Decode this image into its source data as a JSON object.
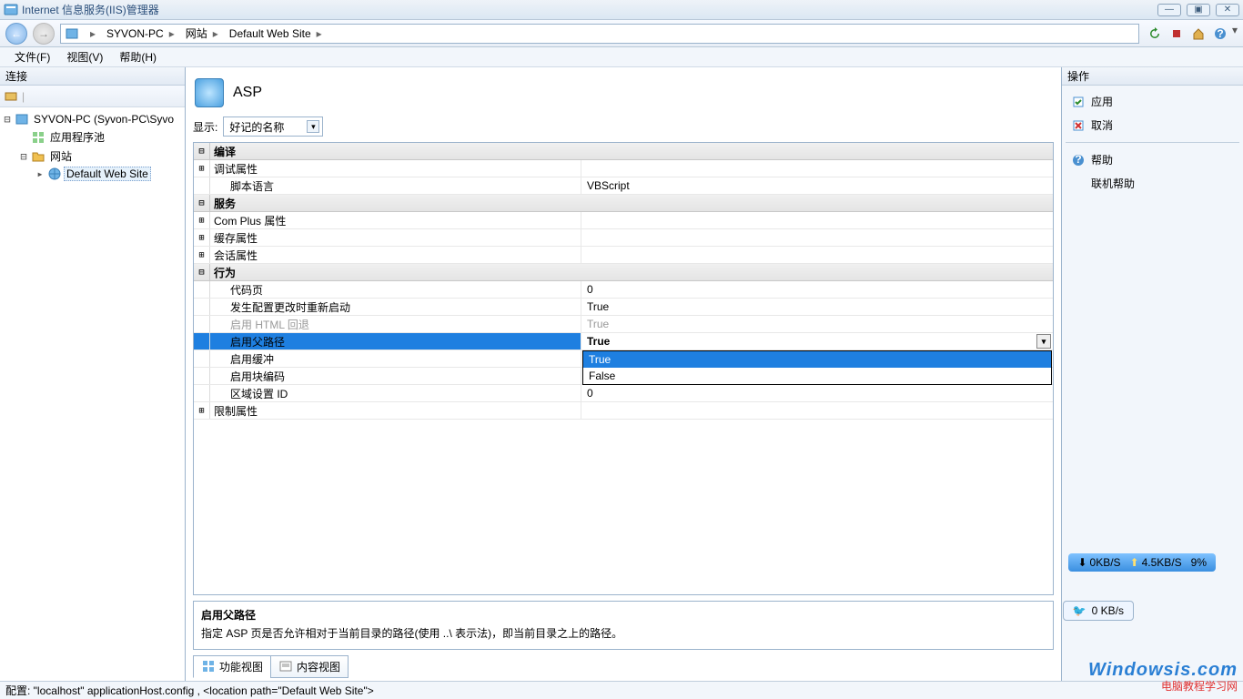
{
  "window": {
    "title": "Internet 信息服务(IIS)管理器"
  },
  "breadcrumbs": [
    "SYVON-PC",
    "网站",
    "Default Web Site"
  ],
  "menu": {
    "file": "文件(F)",
    "view": "视图(V)",
    "help": "帮助(H)"
  },
  "left": {
    "header": "连接",
    "nodes": {
      "root": "SYVON-PC (Syvon-PC\\Syvo",
      "app_pools": "应用程序池",
      "sites": "网站",
      "default_site": "Default Web Site"
    }
  },
  "page": {
    "title": "ASP",
    "filter_label": "显示:",
    "filter_value": "好记的名称"
  },
  "grid": {
    "cat_compile": "编译",
    "debug_props": "调试属性",
    "script_lang": {
      "label": "脚本语言",
      "value": "VBScript"
    },
    "cat_services": "服务",
    "complus": "Com Plus 属性",
    "cache_props": "缓存属性",
    "session_props": "会话属性",
    "cat_behavior": "行为",
    "codepage": {
      "label": "代码页",
      "value": "0"
    },
    "restart_on_cfg": {
      "label": "发生配置更改时重新启动",
      "value": "True"
    },
    "html_fallback": {
      "label": "启用 HTML 回退",
      "value": "True"
    },
    "parent_paths": {
      "label": "启用父路径",
      "value": "True",
      "options": [
        "True",
        "False"
      ]
    },
    "buffering": {
      "label": "启用缓冲",
      "value": ""
    },
    "chunked": {
      "label": "启用块编码",
      "value": ""
    },
    "locale_id": {
      "label": "区域设置 ID",
      "value": "0"
    },
    "limits": "限制属性"
  },
  "description": {
    "title": "启用父路径",
    "body": "指定 ASP 页是否允许相对于当前目录的路径(使用 ..\\ 表示法)，即当前目录之上的路径。"
  },
  "viewtabs": {
    "features": "功能视图",
    "content": "内容视图"
  },
  "right": {
    "header": "操作",
    "apply": "应用",
    "cancel": "取消",
    "help": "帮助",
    "online_help": "联机帮助"
  },
  "status": "配置:  \"localhost\"   applicationHost.config , <location path=\"Default Web Site\">",
  "overlay": {
    "down": "0KB/S",
    "up": "4.5KB/S",
    "pct": "9%",
    "mini": "0 KB/s",
    "wm1": "Windowsis.com",
    "wm2": "电脑教程学习网"
  }
}
